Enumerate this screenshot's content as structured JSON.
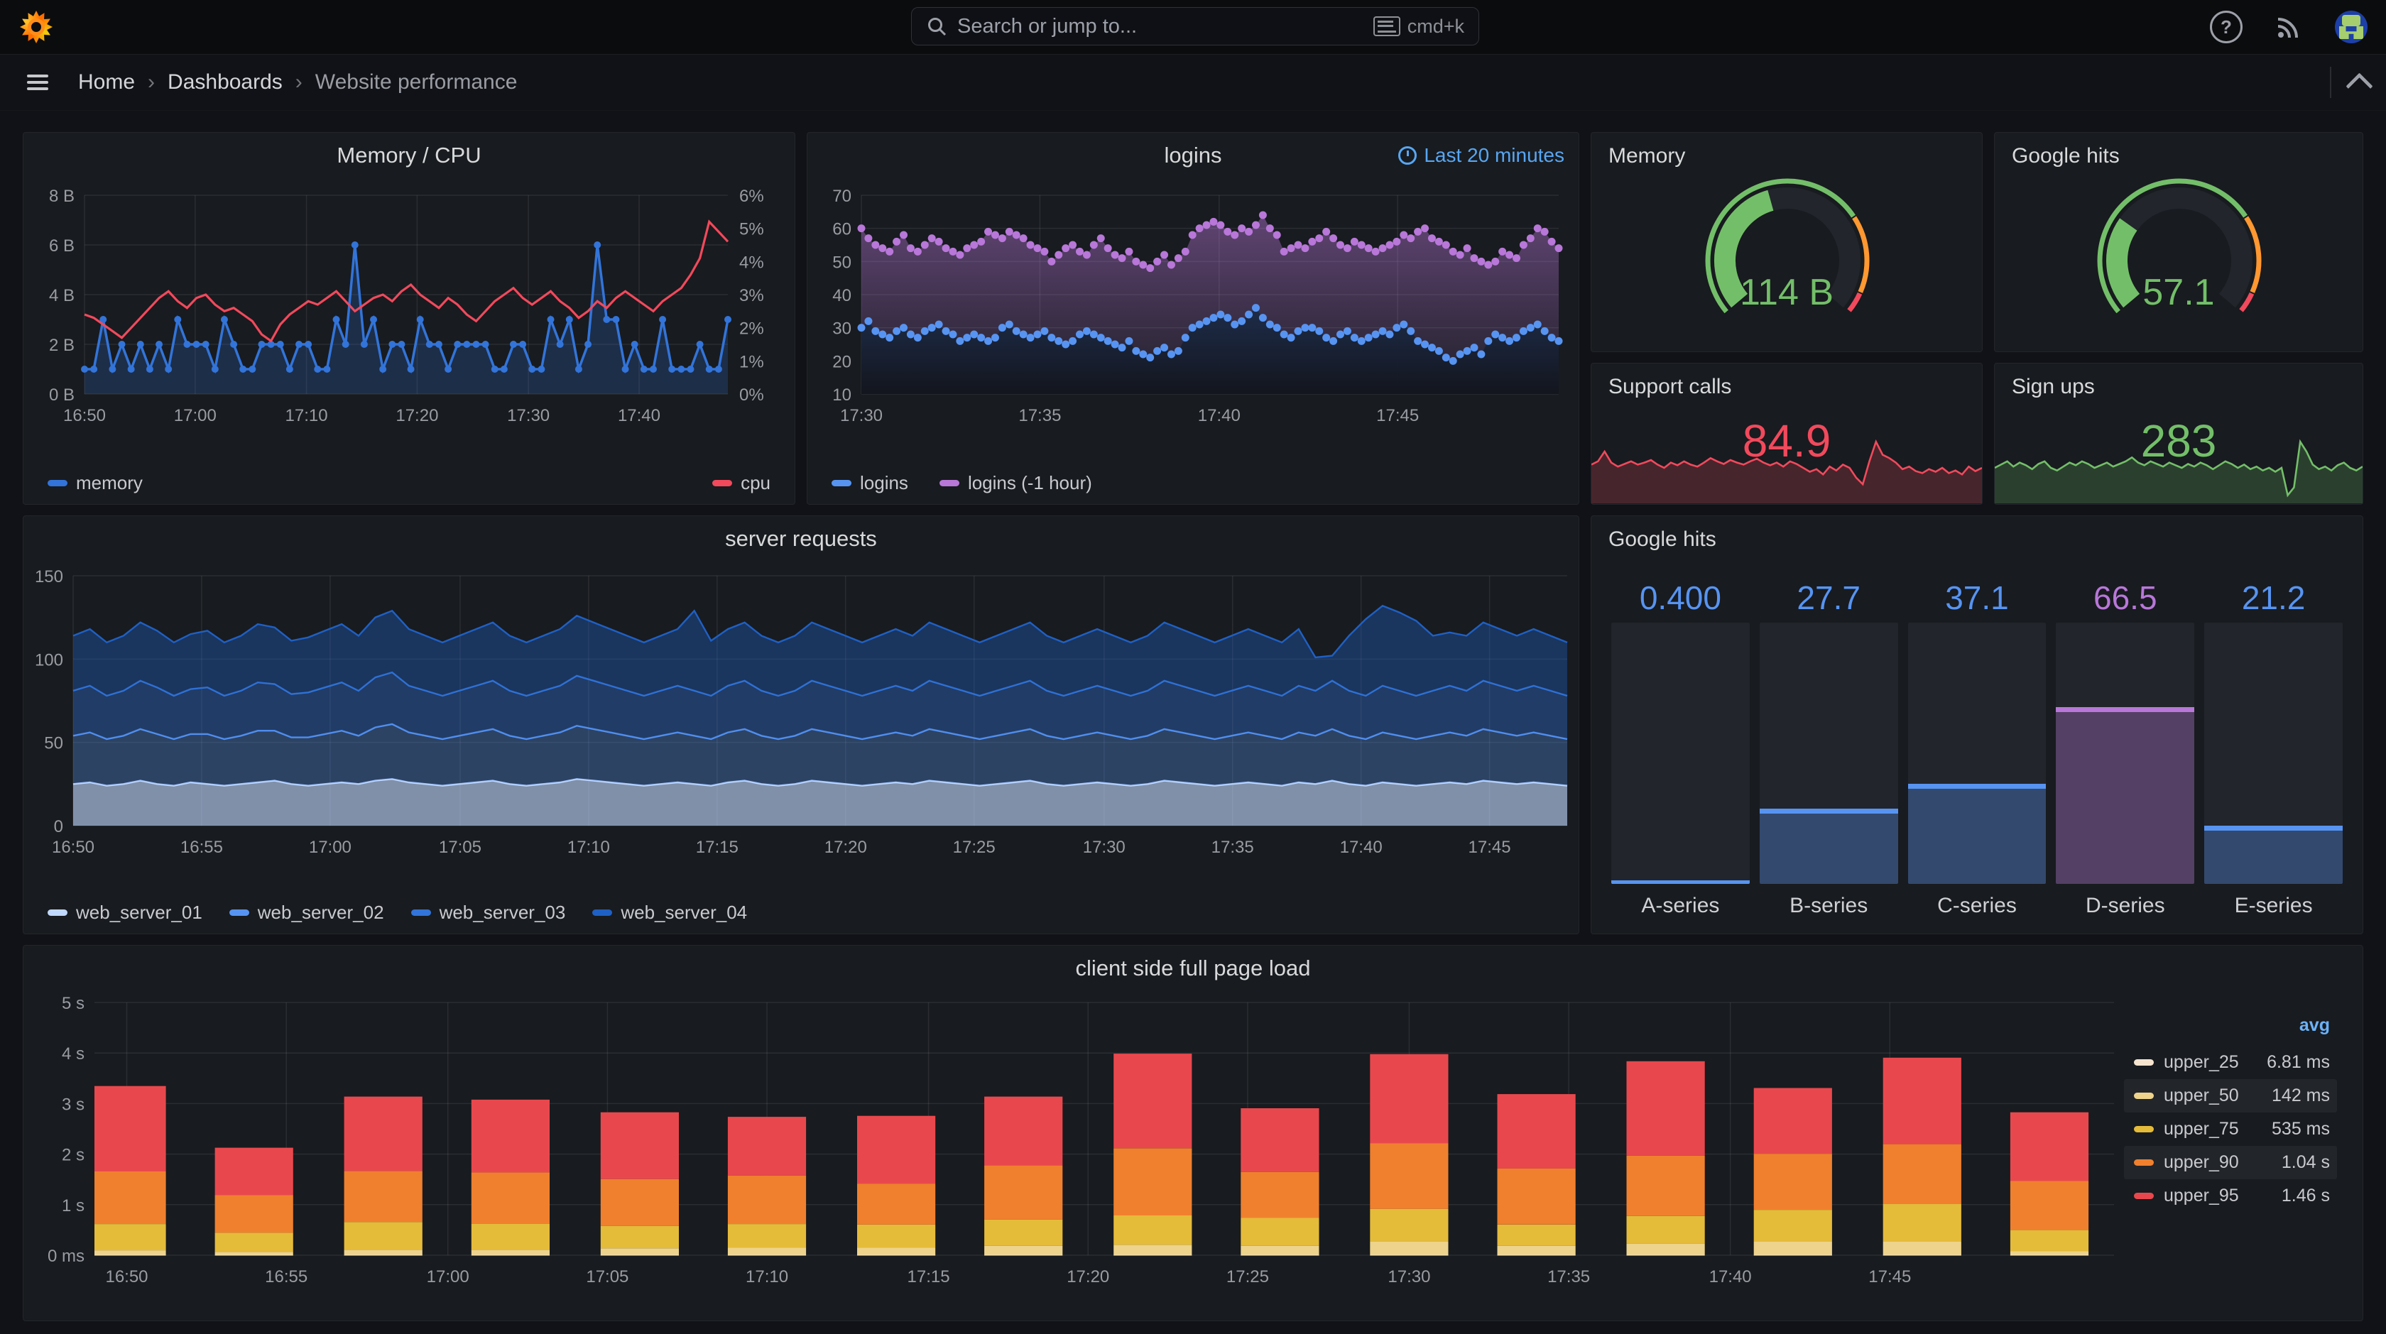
{
  "topbar": {
    "search_placeholder": "Search or jump to...",
    "shortcut": "cmd+k"
  },
  "breadcrumb": {
    "items": [
      "Home",
      "Dashboards",
      "Website performance"
    ]
  },
  "panels": {
    "memcpu": {
      "title": "Memory / CPU",
      "legend": [
        "memory",
        "cpu"
      ]
    },
    "logins": {
      "title": "logins",
      "time_range": "Last 20 minutes",
      "legend": [
        "logins",
        "logins (-1 hour)"
      ]
    },
    "memory_gauge": {
      "title": "Memory",
      "value": "114 B"
    },
    "google_gauge": {
      "title": "Google hits",
      "value": "57.1"
    },
    "support": {
      "title": "Support calls",
      "value": "84.9"
    },
    "signups": {
      "title": "Sign ups",
      "value": "283"
    },
    "server": {
      "title": "server requests",
      "legend": [
        "web_server_01",
        "web_server_02",
        "web_server_03",
        "web_server_04"
      ]
    },
    "bar_gauge": {
      "title": "Google hits"
    },
    "client": {
      "title": "client side full page load"
    }
  },
  "charts": {
    "memcpu": {
      "x_ticks": [
        "16:50",
        "17:00",
        "17:10",
        "17:20",
        "17:30",
        "17:40"
      ],
      "x_fracs": [
        0,
        0.172,
        0.345,
        0.517,
        0.69,
        0.862
      ],
      "y_left": [
        "8 B",
        "6 B",
        "4 B",
        "2 B",
        "0 B"
      ],
      "y_right": [
        "6%",
        "5%",
        "4%",
        "3%",
        "2%",
        "1%",
        "0%"
      ],
      "colors": {
        "memory": "#3274D9",
        "cpu": "#F2495C"
      },
      "memory_max": 8,
      "cpu_max": 6,
      "memory": [
        1,
        1,
        3,
        1,
        2,
        1,
        2,
        1,
        2,
        1,
        3,
        2,
        2,
        2,
        1,
        3,
        2,
        1,
        1,
        2,
        2,
        2,
        1,
        2,
        2,
        1,
        1,
        3,
        2,
        6,
        2,
        3,
        1,
        2,
        2,
        1,
        3,
        2,
        2,
        1,
        2,
        2,
        2,
        2,
        1,
        1,
        2,
        2,
        1,
        1,
        3,
        2,
        3,
        1,
        2,
        6,
        3,
        3,
        1,
        2,
        1,
        1,
        3,
        1,
        1,
        1,
        2,
        1,
        1,
        3
      ],
      "cpu": [
        2.4,
        2.3,
        2.1,
        1.9,
        1.7,
        2.0,
        2.3,
        2.6,
        2.9,
        3.1,
        2.8,
        2.6,
        2.9,
        3.0,
        2.7,
        2.5,
        2.6,
        2.4,
        2.2,
        1.8,
        1.6,
        2.1,
        2.4,
        2.6,
        2.8,
        2.7,
        2.9,
        3.1,
        2.8,
        2.5,
        2.7,
        2.9,
        3.0,
        2.8,
        3.1,
        3.3,
        3.0,
        2.8,
        2.6,
        2.9,
        2.7,
        2.4,
        2.2,
        2.5,
        2.8,
        3.0,
        3.2,
        2.9,
        2.7,
        2.9,
        3.1,
        2.8,
        2.6,
        2.3,
        2.5,
        2.8,
        2.6,
        2.9,
        3.1,
        2.9,
        2.7,
        2.5,
        2.8,
        3.0,
        3.2,
        3.6,
        4.1,
        5.2,
        4.9,
        4.6
      ]
    },
    "logins": {
      "x_ticks": [
        "17:30",
        "17:35",
        "17:40",
        "17:45"
      ],
      "x_fracs": [
        0,
        0.256,
        0.513,
        0.769
      ],
      "y_ticks": [
        "70",
        "60",
        "50",
        "40",
        "30",
        "20",
        "10"
      ],
      "y_min": 10,
      "y_max": 70,
      "colors": {
        "logins": "#5794F2",
        "logins_prev": "#B877D9"
      },
      "logins_prev": [
        60,
        57,
        55,
        54,
        53,
        56,
        58,
        54,
        53,
        55,
        57,
        56,
        54,
        53,
        52,
        54,
        55,
        56,
        59,
        58,
        57,
        59,
        58,
        57,
        55,
        54,
        53,
        50,
        52,
        54,
        55,
        53,
        52,
        55,
        57,
        54,
        52,
        51,
        53,
        50,
        49,
        48,
        50,
        52,
        49,
        51,
        53,
        58,
        60,
        61,
        62,
        61,
        59,
        58,
        60,
        59,
        61,
        64,
        60,
        58,
        53,
        54,
        55,
        54,
        56,
        57,
        59,
        57,
        55,
        54,
        56,
        55,
        54,
        53,
        54,
        55,
        56,
        58,
        57,
        59,
        60,
        57,
        56,
        55,
        53,
        52,
        54,
        51,
        50,
        49,
        50,
        53,
        52,
        51,
        55,
        57,
        60,
        59,
        56,
        54
      ],
      "logins": [
        30,
        32,
        29,
        28,
        27,
        29,
        30,
        28,
        27,
        29,
        30,
        31,
        29,
        28,
        26,
        27,
        28,
        27,
        26,
        27,
        30,
        31,
        29,
        28,
        27,
        28,
        29,
        27,
        26,
        25,
        26,
        28,
        29,
        28,
        27,
        26,
        25,
        24,
        26,
        23,
        22,
        21,
        23,
        24,
        22,
        23,
        27,
        30,
        31,
        32,
        33,
        34,
        33,
        31,
        32,
        34,
        36,
        33,
        31,
        30,
        28,
        27,
        29,
        30,
        30,
        29,
        27,
        26,
        28,
        29,
        27,
        26,
        27,
        28,
        29,
        28,
        30,
        31,
        29,
        26,
        25,
        24,
        23,
        21,
        20,
        22,
        23,
        24,
        22,
        26,
        28,
        27,
        26,
        27,
        29,
        30,
        31,
        29,
        27,
        26
      ]
    },
    "server": {
      "x_ticks": [
        "16:50",
        "16:55",
        "17:00",
        "17:05",
        "17:10",
        "17:15",
        "17:20",
        "17:25",
        "17:30",
        "17:35",
        "17:40",
        "17:45"
      ],
      "x_fracs": [
        0,
        0.086,
        0.172,
        0.259,
        0.345,
        0.431,
        0.517,
        0.603,
        0.69,
        0.776,
        0.862,
        0.948
      ],
      "y_ticks": [
        "150",
        "100",
        "50",
        "0"
      ],
      "y_max": 150,
      "series": [
        {
          "name": "web_server_01",
          "color": "#C0D8FF",
          "fill_opacity": 0.62,
          "values": [
            25,
            26,
            24,
            25,
            27,
            25,
            24,
            26,
            25,
            24,
            25,
            26,
            27,
            25,
            24,
            25,
            26,
            25,
            27,
            28,
            26,
            25,
            24,
            25,
            26,
            27,
            25,
            24,
            25,
            26,
            28,
            27,
            26,
            25,
            24,
            25,
            26,
            25,
            24,
            26,
            27,
            25,
            24,
            25,
            27,
            26,
            25,
            24,
            25,
            26,
            25,
            27,
            26,
            25,
            24,
            25,
            26,
            27,
            25,
            24,
            25,
            26,
            25,
            24,
            25,
            27,
            26,
            25,
            24,
            25,
            26,
            25,
            24,
            26,
            25,
            27,
            25,
            24,
            26,
            25,
            24,
            25,
            26,
            25,
            27,
            26,
            25,
            26,
            25,
            24
          ]
        },
        {
          "name": "web_server_02",
          "color": "#5794F2",
          "fill_opacity": 0.33,
          "values": [
            29,
            30,
            28,
            29,
            31,
            30,
            28,
            29,
            30,
            28,
            29,
            31,
            30,
            28,
            29,
            30,
            31,
            29,
            32,
            33,
            30,
            29,
            28,
            29,
            30,
            31,
            29,
            28,
            29,
            30,
            32,
            31,
            30,
            29,
            28,
            29,
            30,
            29,
            28,
            30,
            31,
            29,
            28,
            29,
            31,
            30,
            29,
            28,
            29,
            30,
            29,
            31,
            30,
            29,
            28,
            29,
            30,
            31,
            29,
            28,
            29,
            30,
            29,
            28,
            29,
            31,
            30,
            29,
            28,
            29,
            30,
            29,
            28,
            30,
            29,
            31,
            29,
            28,
            30,
            29,
            28,
            29,
            30,
            29,
            31,
            30,
            29,
            30,
            29,
            28
          ]
        },
        {
          "name": "web_server_03",
          "color": "#3274D9",
          "fill_opacity": 0.38,
          "values": [
            27,
            28,
            26,
            27,
            29,
            28,
            26,
            27,
            28,
            26,
            27,
            29,
            28,
            26,
            27,
            28,
            29,
            27,
            30,
            31,
            28,
            27,
            26,
            27,
            28,
            29,
            27,
            26,
            27,
            28,
            30,
            29,
            28,
            27,
            26,
            27,
            28,
            27,
            26,
            28,
            29,
            27,
            26,
            27,
            29,
            28,
            27,
            26,
            27,
            28,
            27,
            29,
            28,
            27,
            26,
            27,
            28,
            29,
            27,
            26,
            27,
            28,
            27,
            26,
            27,
            29,
            28,
            27,
            26,
            27,
            28,
            27,
            26,
            28,
            27,
            29,
            27,
            26,
            28,
            27,
            26,
            27,
            28,
            27,
            29,
            28,
            27,
            28,
            27,
            26
          ]
        },
        {
          "name": "web_server_04",
          "color": "#1F60C4",
          "fill_opacity": 0.38,
          "values": [
            33,
            34,
            32,
            33,
            35,
            34,
            32,
            33,
            34,
            32,
            33,
            35,
            34,
            32,
            33,
            34,
            35,
            33,
            36,
            37,
            34,
            33,
            32,
            33,
            34,
            35,
            33,
            32,
            33,
            34,
            36,
            35,
            34,
            33,
            32,
            33,
            34,
            48,
            33,
            34,
            35,
            33,
            32,
            33,
            35,
            34,
            33,
            32,
            33,
            34,
            33,
            35,
            34,
            33,
            32,
            33,
            34,
            35,
            33,
            32,
            33,
            34,
            33,
            32,
            33,
            35,
            34,
            33,
            32,
            33,
            34,
            33,
            32,
            34,
            20,
            15,
            33,
            46,
            48,
            47,
            45,
            33,
            32,
            33,
            35,
            34,
            33,
            34,
            33,
            32
          ]
        }
      ]
    },
    "gauges": {
      "memory": {
        "fraction": 0.44,
        "value_color": "#73BF69",
        "thresholds": [
          [
            0,
            0.72,
            "#73BF69"
          ],
          [
            0.72,
            0.94,
            "#FF9830"
          ],
          [
            0.94,
            1,
            "#F2495C"
          ]
        ]
      },
      "google": {
        "fraction": 0.29,
        "value_color": "#73BF69",
        "thresholds": [
          [
            0,
            0.72,
            "#73BF69"
          ],
          [
            0.72,
            0.94,
            "#FF9830"
          ],
          [
            0.94,
            1,
            "#F2495C"
          ]
        ]
      }
    },
    "stats": {
      "support": {
        "color": "#F2495C",
        "spark": [
          55,
          60,
          75,
          58,
          52,
          56,
          60,
          55,
          58,
          62,
          55,
          50,
          58,
          54,
          60,
          55,
          52,
          58,
          65,
          60,
          56,
          62,
          58,
          55,
          60,
          64,
          58,
          54,
          58,
          52,
          60,
          56,
          50,
          44,
          48,
          40,
          52,
          46,
          55,
          50,
          35,
          25,
          60,
          90,
          70,
          65,
          58,
          48,
          52,
          45,
          42,
          48,
          44,
          50,
          42,
          46,
          40,
          52,
          45,
          50
        ]
      },
      "signups": {
        "color": "#73BF69",
        "spark": [
          50,
          55,
          60,
          52,
          58,
          54,
          48,
          56,
          60,
          50,
          46,
          52,
          58,
          54,
          60,
          56,
          50,
          54,
          58,
          52,
          56,
          60,
          66,
          58,
          54,
          60,
          56,
          52,
          58,
          54,
          50,
          56,
          52,
          58,
          54,
          48,
          54,
          60,
          56,
          50,
          55,
          48,
          52,
          46,
          50,
          44,
          50,
          8,
          20,
          90,
          75,
          55,
          48,
          52,
          46,
          54,
          58,
          50,
          46,
          52
        ]
      }
    },
    "bar_gauge": {
      "values": [
        "0.400",
        "27.7",
        "37.1",
        "66.5",
        "21.2"
      ],
      "fractions": [
        0.004,
        0.277,
        0.371,
        0.665,
        0.212
      ],
      "labels": [
        "A-series",
        "B-series",
        "C-series",
        "D-series",
        "E-series"
      ],
      "colors": [
        "#5794F2",
        "#5794F2",
        "#5794F2",
        "#B877D9",
        "#5794F2"
      ]
    },
    "client": {
      "x_ticks": [
        "16:50",
        "16:55",
        "17:00",
        "17:05",
        "17:10",
        "17:15",
        "17:20",
        "17:25",
        "17:30",
        "17:35",
        "17:40",
        "17:45"
      ],
      "x_fracs": [
        0.016,
        0.095,
        0.175,
        0.254,
        0.333,
        0.413,
        0.492,
        0.571,
        0.651,
        0.73,
        0.81,
        0.889
      ],
      "bar_fracs": [
        0.016,
        0.079,
        0.143,
        0.206,
        0.27,
        0.333,
        0.397,
        0.46,
        0.524,
        0.587,
        0.651,
        0.714,
        0.778,
        0.841,
        0.905,
        0.968
      ],
      "y_ticks": [
        "5 s",
        "4 s",
        "3 s",
        "2 s",
        "1 s",
        "0 ms"
      ],
      "y_max": 5,
      "colors": [
        "#f6e4cf",
        "#edd38b",
        "#e5bb3a",
        "#f0802e",
        "#e8484d"
      ],
      "u25": 0.007,
      "u50": [
        0.09,
        0.06,
        0.1,
        0.1,
        0.13,
        0.14,
        0.14,
        0.18,
        0.2,
        0.18,
        0.27,
        0.18,
        0.22,
        0.26,
        0.26,
        0.07
      ],
      "u75": [
        0.52,
        0.38,
        0.55,
        0.52,
        0.44,
        0.47,
        0.46,
        0.52,
        0.58,
        0.55,
        0.64,
        0.42,
        0.55,
        0.63,
        0.75,
        0.42
      ],
      "u90": [
        1.04,
        0.74,
        1.01,
        1.01,
        0.93,
        0.96,
        0.81,
        1.07,
        1.33,
        0.91,
        1.3,
        1.11,
        1.19,
        1.11,
        1.18,
        0.97
      ],
      "u95": [
        1.69,
        0.94,
        1.47,
        1.44,
        1.32,
        1.16,
        1.34,
        1.36,
        1.87,
        1.26,
        1.76,
        1.47,
        1.87,
        1.3,
        1.71,
        1.36
      ],
      "legend": {
        "header": "avg",
        "rows": [
          {
            "name": "upper_25",
            "value": "6.81 ms"
          },
          {
            "name": "upper_50",
            "value": "142 ms"
          },
          {
            "name": "upper_75",
            "value": "535 ms"
          },
          {
            "name": "upper_90",
            "value": "1.04 s"
          },
          {
            "name": "upper_95",
            "value": "1.46 s"
          }
        ]
      }
    }
  }
}
